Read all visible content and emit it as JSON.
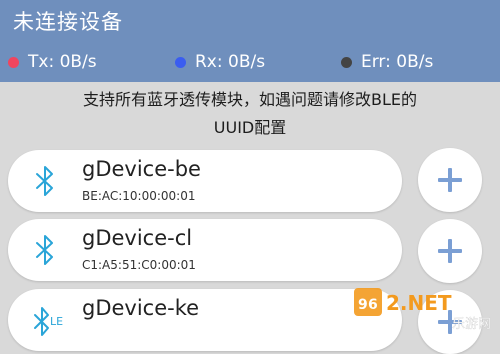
{
  "header": {
    "title": "未连接设备",
    "stats": [
      {
        "label": "Tx: 0B/s",
        "color": "#f0455f"
      },
      {
        "label": "Rx: 0B/s",
        "color": "#3a5df0"
      },
      {
        "label": "Err: 0B/s",
        "color": "#444444"
      }
    ]
  },
  "notice": {
    "line1": "支持所有蓝牙透传模块，如遇问题请修改BLE的",
    "line2": "UUID配置"
  },
  "devices": [
    {
      "name": "gDevice-be",
      "mac": "BE:AC:10:00:00:01",
      "icon": "bluetooth-icon"
    },
    {
      "name": "gDevice-cl",
      "mac": "C1:A5:51:C0:00:01",
      "icon": "bluetooth-icon"
    },
    {
      "name": "gDevice-ke",
      "mac": "",
      "icon": "bluetooth-le-icon",
      "icon_badge": "LE"
    }
  ],
  "watermark": {
    "brand": "962.NET",
    "sub": "乐游网"
  },
  "colors": {
    "appbar": "#6f8fbd",
    "accent": "#2aa5d8",
    "add": "#7b9fd4"
  }
}
